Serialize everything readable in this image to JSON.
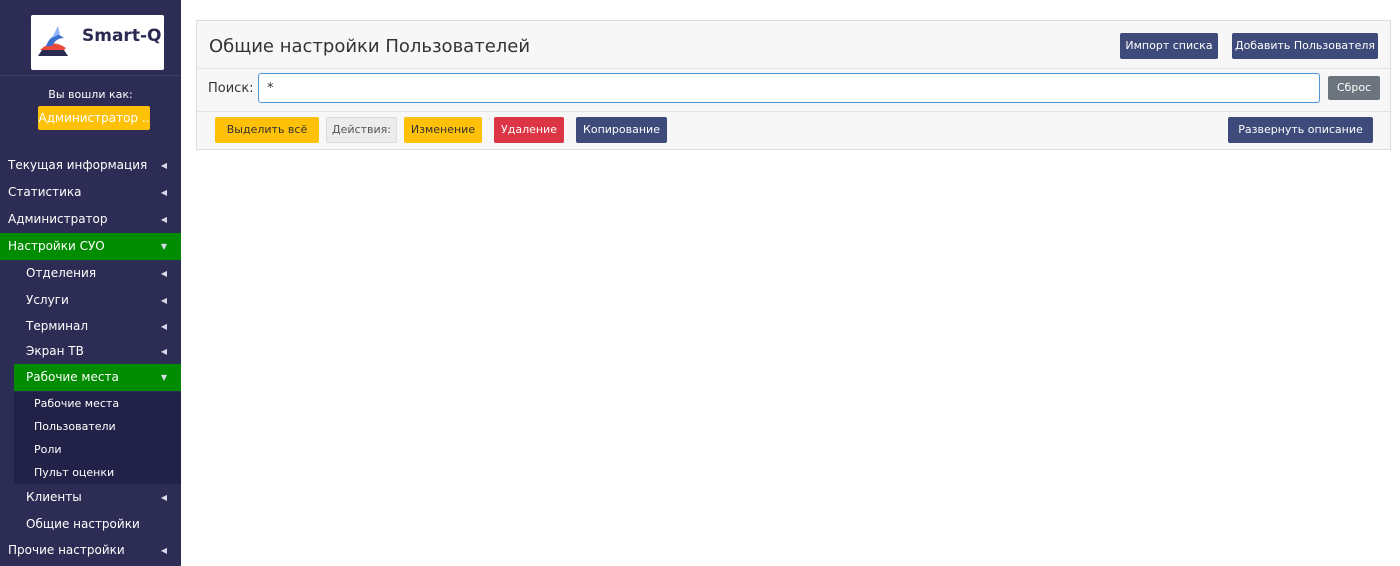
{
  "sidebar": {
    "logo_text": "Smart-Q",
    "logged_in_label": "Вы вошли как:",
    "user_button_label": "Администратор ..",
    "menu": {
      "current_info": "Текущая информация",
      "statistics": "Статистика",
      "administrator": "Администратор",
      "suo_settings": "Настройки СУО",
      "departments": "Отделения",
      "services": "Услуги",
      "terminal": "Терминал",
      "tv_screen": "Экран ТВ",
      "workplaces": "Рабочие места",
      "workplaces_sub": "Рабочие места",
      "users": "Пользователи",
      "roles": "Роли",
      "rating_panel": "Пульт оценки",
      "clients": "Клиенты",
      "general_settings": "Общие настройки",
      "other_settings": "Прочие настройки"
    },
    "active_color": "#008c00",
    "background_color": "#2c2c54"
  },
  "panel": {
    "title": "Общие настройки Пользователей",
    "import_label": "Импорт списка",
    "add_user_label": "Добавить Пользователя",
    "search_label": "Поиск:",
    "search_value": "*",
    "reset_label": "Сброс",
    "select_all_label": "Выделить всё",
    "actions_label": "Действия:",
    "edit_label": "Изменение",
    "delete_label": "Удаление",
    "copy_label": "Копирование",
    "expand_label": "Развернуть описание"
  },
  "colors": {
    "accent_yellow": "#ffc107",
    "navy_button": "#3d4a7a",
    "danger_red": "#dc3545",
    "secondary_gray": "#6c757d"
  },
  "icons": [
    "logo-icon",
    "chevron-left-icon",
    "chevron-down-icon"
  ]
}
